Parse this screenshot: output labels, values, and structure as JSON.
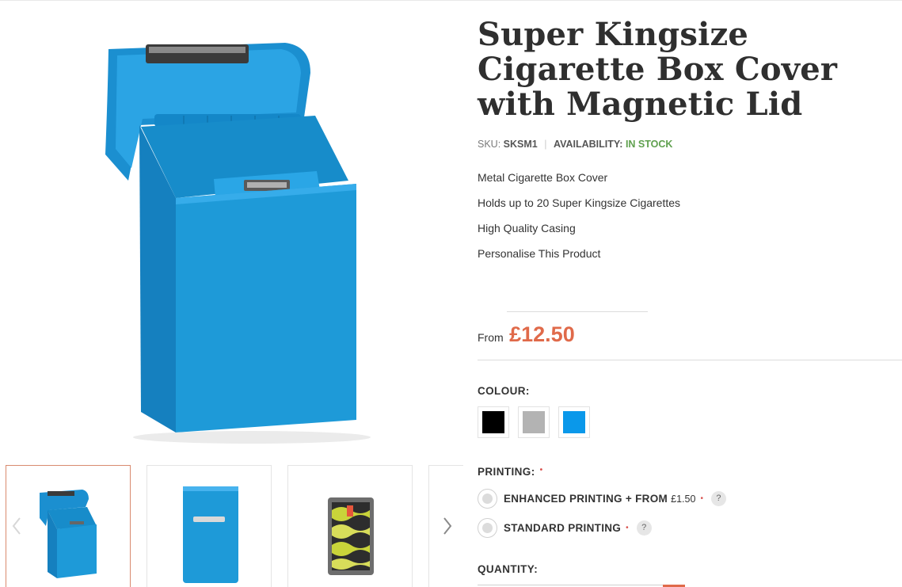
{
  "product": {
    "title": "Super Kingsize Cigarette Box Cover with Magnetic Lid",
    "sku_label": "SKU:",
    "sku": "SKSM1",
    "availability_label": "AVAILABILITY:",
    "availability": "IN STOCK",
    "features": [
      "Metal Cigarette Box Cover",
      "Holds up to 20 Super Kingsize Cigarettes",
      "High Quality Casing",
      "Personalise This Product"
    ],
    "price_prefix": "From",
    "price": "£12.50"
  },
  "images": {
    "main": "blue-cigarette-box-open",
    "thumbnails": [
      {
        "name": "blue-box-open",
        "active": true
      },
      {
        "name": "blue-box-closed",
        "active": false
      },
      {
        "name": "printed-box-pattern",
        "active": false
      },
      {
        "name": "partial-next-thumbnail",
        "active": false
      }
    ]
  },
  "options": {
    "colour_label": "COLOUR:",
    "colours": [
      {
        "name": "black",
        "hex": "#000000"
      },
      {
        "name": "silver",
        "hex": "#b3b3b3"
      },
      {
        "name": "blue",
        "hex": "#0a98ea"
      }
    ],
    "printing_label": "PRINTING:",
    "printing_choices": [
      {
        "label": "ENHANCED PRINTING + FROM",
        "extra": "£1.50"
      },
      {
        "label": "STANDARD PRINTING",
        "extra": ""
      }
    ],
    "help_glyph": "?",
    "required_glyph": "•",
    "quantity_label": "QUANTITY:"
  },
  "theme": {
    "accent": "#e06a4a",
    "in_stock": "#5fa04e",
    "product_blue": "#1e9ad8"
  }
}
